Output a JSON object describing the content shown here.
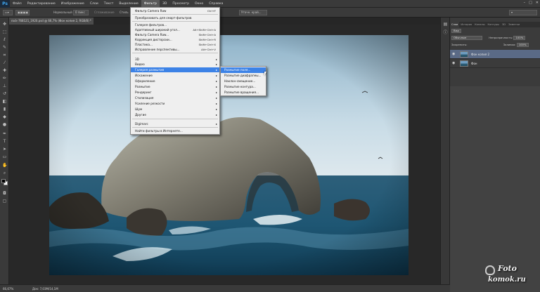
{
  "menubar": {
    "logo": "Ps",
    "items": [
      "Файл",
      "Редактирование",
      "Изображение",
      "Слои",
      "Текст",
      "Выделение",
      "Фильтр",
      "3D",
      "Просмотр",
      "Окно",
      "Справка"
    ],
    "active_index": 6,
    "window_controls": [
      "–",
      "□",
      "✕"
    ]
  },
  "options_bar": {
    "tool_mode": "Нормальный",
    "field": "0 пикс",
    "antialias": "Сглаживание",
    "style": "Стиль",
    "refine": "Уточн. край..."
  },
  "document": {
    "tab_title": "rock-768121_1920.psd @ 66,7% (Фон копия 2, RGB/8) *"
  },
  "filter_menu": {
    "items": [
      {
        "label": "Фильтр Camera Raw",
        "shortcut": "Ctrl+F",
        "submenu": false
      },
      {
        "label": "Преобразовать для смарт-фильтров",
        "shortcut": "",
        "submenu": false
      },
      {
        "label": "Галерея фильтров...",
        "shortcut": "",
        "submenu": false
      },
      {
        "label": "Адаптивный широкий угол...",
        "shortcut": "Alt+Shift+Ctrl+A",
        "submenu": false
      },
      {
        "label": "Фильтр Camera Raw...",
        "shortcut": "Shift+Ctrl+A",
        "submenu": false
      },
      {
        "label": "Коррекция дисторсии...",
        "shortcut": "Shift+Ctrl+R",
        "submenu": false
      },
      {
        "label": "Пластика...",
        "shortcut": "Shift+Ctrl+X",
        "submenu": false
      },
      {
        "label": "Исправление перспективы...",
        "shortcut": "Alt+Ctrl+V",
        "submenu": false
      },
      {
        "label": "3D",
        "shortcut": "",
        "submenu": true
      },
      {
        "label": "Видео",
        "shortcut": "",
        "submenu": true
      },
      {
        "label": "Галерея размытия",
        "shortcut": "",
        "submenu": true
      },
      {
        "label": "Искажение",
        "shortcut": "",
        "submenu": true
      },
      {
        "label": "Оформление",
        "shortcut": "",
        "submenu": true
      },
      {
        "label": "Размытие",
        "shortcut": "",
        "submenu": true
      },
      {
        "label": "Рендеринг",
        "shortcut": "",
        "submenu": true
      },
      {
        "label": "Стилизация",
        "shortcut": "",
        "submenu": true
      },
      {
        "label": "Усиление резкости",
        "shortcut": "",
        "submenu": true
      },
      {
        "label": "Шум",
        "shortcut": "",
        "submenu": true
      },
      {
        "label": "Другие",
        "shortcut": "",
        "submenu": true
      },
      {
        "label": "Digimarc",
        "shortcut": "",
        "submenu": true
      },
      {
        "label": "Найти фильтры в Интернете...",
        "shortcut": "",
        "submenu": false
      }
    ],
    "highlighted_index": 10
  },
  "blur_gallery_submenu": {
    "items": [
      "Размытие поля...",
      "Размытие диафрагмы...",
      "Наклон-смещение...",
      "Размытие контура...",
      "Размытие вращения..."
    ],
    "highlighted_index": 0
  },
  "layers_panel": {
    "tabs": [
      "Слои",
      "История",
      "Каналы",
      "Контуры",
      "3D",
      "Заметки"
    ],
    "active_tab": 0,
    "kind_filter": "Вид",
    "blend_mode": "Обычные",
    "opacity_label": "Непрозрачность:",
    "opacity_value": "100%",
    "lock_label": "Закрепить:",
    "fill_label": "Заливка:",
    "fill_value": "100%",
    "layers": [
      {
        "name": "Фон копия 2",
        "selected": true
      },
      {
        "name": "Фон",
        "selected": false
      }
    ]
  },
  "status": {
    "zoom": "66,67%",
    "doc_size": "Док: 7,03M/14,1M"
  },
  "watermark": {
    "line1": "Foto",
    "line2": "komok.ru"
  },
  "colors": {
    "highlight": "#3c82e6",
    "layer_selected": "#5a6a86",
    "app_bg": "#2b2b2b"
  }
}
